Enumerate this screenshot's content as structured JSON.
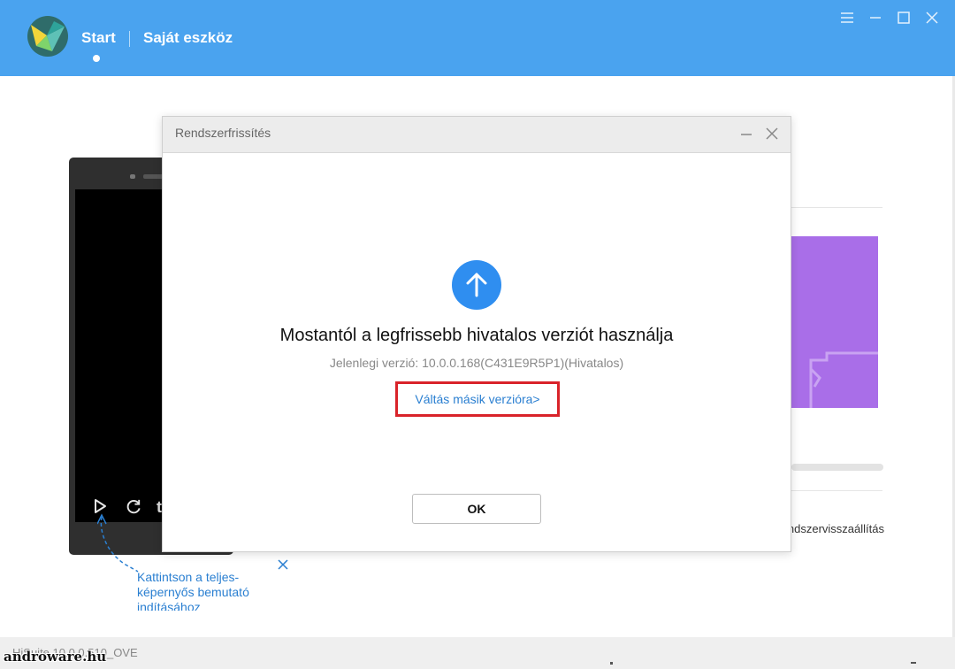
{
  "app": {
    "nav": {
      "start_label": "Start",
      "device_label": "Saját eszköz"
    },
    "window_controls": [
      "menu-icon",
      "minimize-icon",
      "maximize-icon",
      "close-icon"
    ]
  },
  "background": {
    "phone_hint": {
      "text": "Kattintson a teljes-képernyős bemutató indításához"
    },
    "right_panel": {
      "restore_label": "Rendszervisszaállítás"
    },
    "footer": {
      "version": "HiSuite 10.0.0.510_OVE",
      "watermark": "androware.hu"
    }
  },
  "dialog": {
    "title": "Rendszerfrissítés",
    "headline": "Mostantól a legfrissebb hivatalos verziót használja",
    "current_version": "Jelenlegi verzió: 10.0.0.168(C431E9R5P1)(Hivatalos)",
    "switch_link": "Váltás másik verzióra>",
    "ok_label": "OK"
  },
  "colors": {
    "header_bg": "#4aa3ef",
    "accent_blue": "#2f8ef0",
    "link_blue": "#2a7fd1",
    "highlight_red": "#d9232a",
    "purple_card": "#a96ee8"
  }
}
